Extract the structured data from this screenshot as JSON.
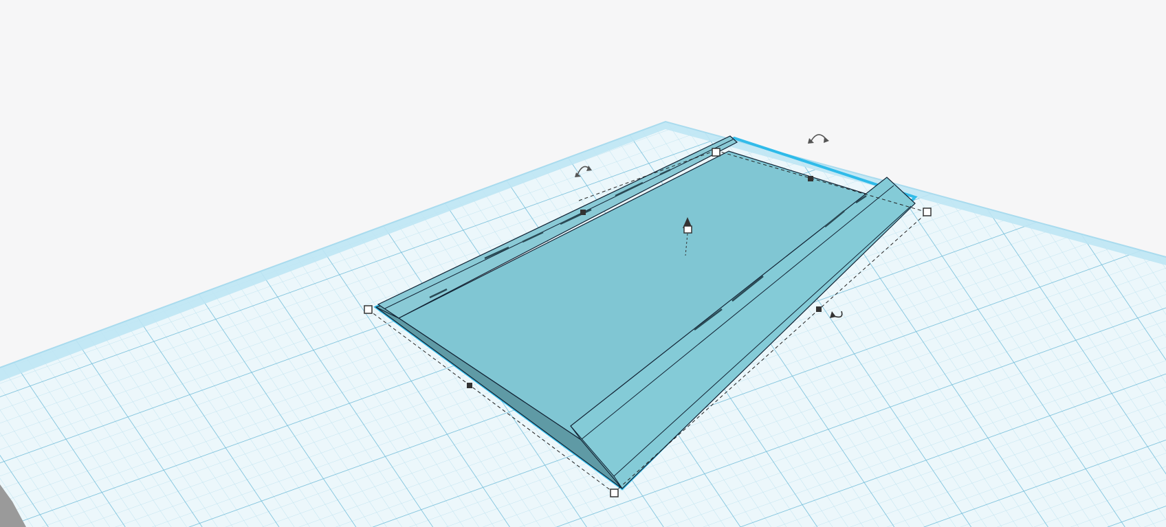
{
  "app": {
    "view": "3d-workplane",
    "background_color": "#f6f6f7",
    "workplane_color": "#e9f5fa",
    "grid_minor_color": "#bfe3f0",
    "grid_major_color": "#5fb6d6",
    "shape_color": "#80c6d3",
    "shape_side_color": "#64a2ad",
    "selection_outline_color": "#1fb6e8"
  },
  "selection": {
    "shape": "selected-shape",
    "handles": [
      "corner-handle-left",
      "corner-handle-top",
      "corner-handle-right",
      "corner-handle-bottom"
    ],
    "midpoint_handles": [
      "edge-handle-top",
      "edge-handle-right",
      "edge-handle-bottom",
      "edge-handle-left"
    ],
    "rotate_icons": [
      "rotate-arrow-icon",
      "rotate-arrow-icon",
      "rotate-arrow-icon"
    ],
    "lift_icon": "lift-cone-icon"
  }
}
